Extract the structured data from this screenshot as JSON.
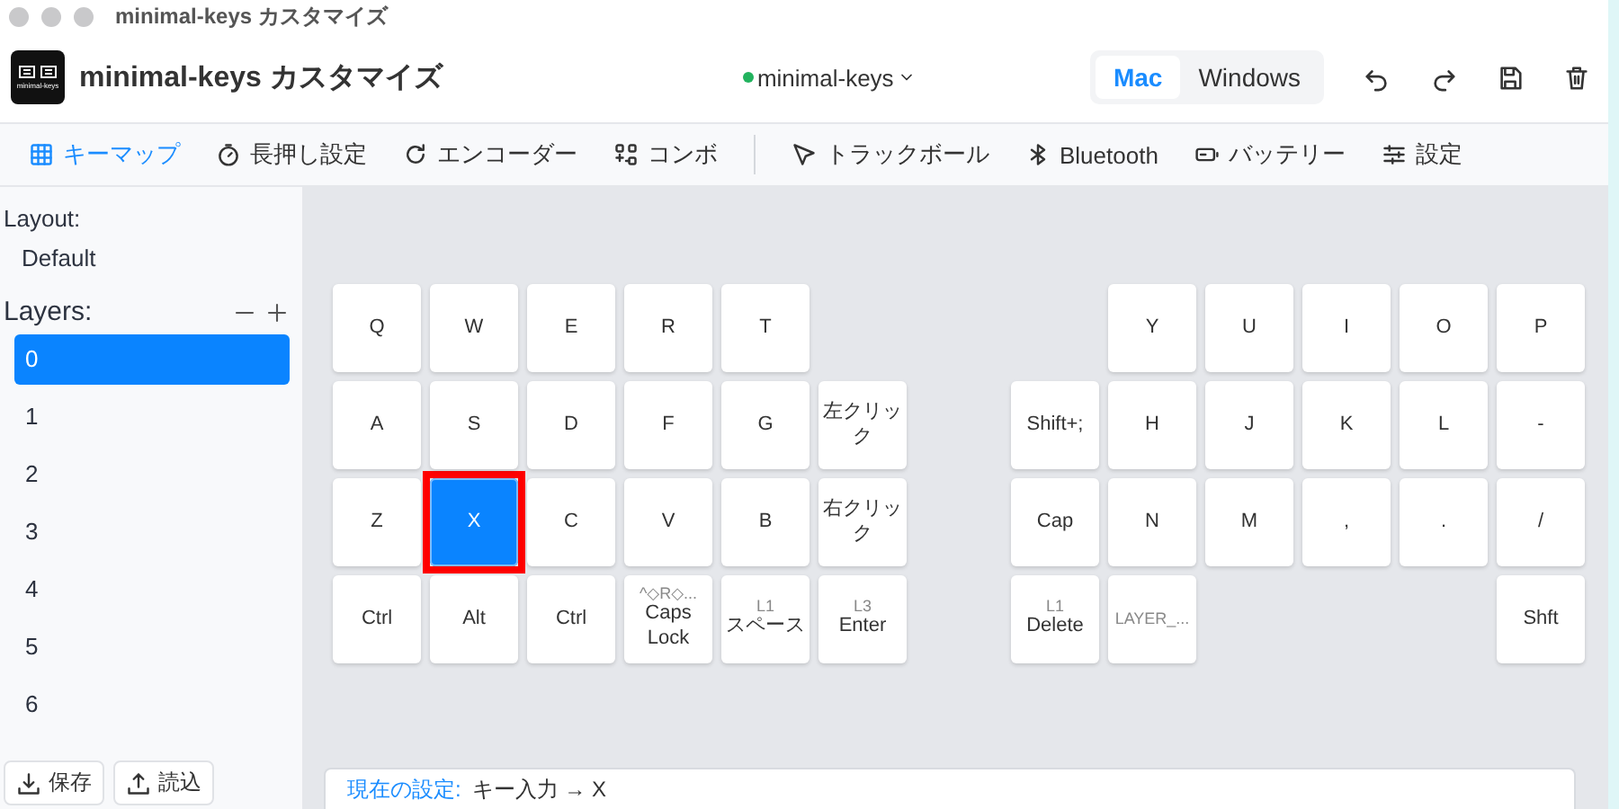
{
  "window": {
    "title": "minimal-keys カスタマイズ"
  },
  "header": {
    "logo_text": "minimal-keys",
    "title": "minimal-keys カスタマイズ",
    "device": {
      "name": "minimal-keys",
      "connected": true
    },
    "os_toggle": [
      {
        "label": "Mac",
        "selected": true
      },
      {
        "label": "Windows",
        "selected": false
      }
    ]
  },
  "toolbar": [
    {
      "label": "キーマップ",
      "selected": true
    },
    {
      "label": "長押し設定",
      "selected": false
    },
    {
      "label": "エンコーダー",
      "selected": false
    },
    {
      "label": "コンボ",
      "selected": false
    },
    {
      "label": "トラックボール",
      "selected": false,
      "divider_before": true
    },
    {
      "label": "Bluetooth",
      "selected": false
    },
    {
      "label": "バッテリー",
      "selected": false
    },
    {
      "label": "設定",
      "selected": false
    }
  ],
  "sidebar": {
    "layout_label": "Layout:",
    "layout_value": "Default",
    "layers_label": "Layers:",
    "layers": [
      {
        "label": "0",
        "selected": true
      },
      {
        "label": "1",
        "selected": false
      },
      {
        "label": "2",
        "selected": false
      },
      {
        "label": "3",
        "selected": false
      },
      {
        "label": "4",
        "selected": false
      },
      {
        "label": "5",
        "selected": false
      },
      {
        "label": "6",
        "selected": false
      }
    ],
    "buttons": [
      {
        "label": "保存"
      },
      {
        "label": "読込"
      }
    ]
  },
  "keyboard": {
    "halves": [
      {
        "rows": [
          [
            {
              "label": "Q",
              "selected": false
            },
            {
              "label": "W",
              "selected": false
            },
            {
              "label": "E",
              "selected": false
            },
            {
              "label": "R",
              "selected": false
            },
            {
              "label": "T",
              "selected": false
            },
            null
          ],
          [
            {
              "label": "A",
              "selected": false
            },
            {
              "label": "S",
              "selected": false
            },
            {
              "label": "D",
              "selected": false
            },
            {
              "label": "F",
              "selected": false
            },
            {
              "label": "G",
              "selected": false
            },
            {
              "label": "左クリック",
              "selected": false
            }
          ],
          [
            {
              "label": "Z",
              "selected": false
            },
            {
              "label": "X",
              "selected": true,
              "marked": true
            },
            {
              "label": "C",
              "selected": false
            },
            {
              "label": "V",
              "selected": false
            },
            {
              "label": "B",
              "selected": false
            },
            {
              "label": "右クリック",
              "selected": false
            }
          ],
          [
            {
              "label": "Ctrl",
              "selected": false
            },
            {
              "label": "Alt",
              "selected": false
            },
            {
              "label": "Ctrl",
              "selected": false
            },
            {
              "label": "Caps Lock",
              "sublabel": "^◇R◇...",
              "selected": false
            },
            {
              "label": "スペース",
              "sublabel": "L1",
              "selected": false
            },
            {
              "label": "Enter",
              "sublabel": "L3",
              "selected": false
            }
          ]
        ]
      },
      {
        "rows": [
          [
            null,
            {
              "label": "Y",
              "selected": false
            },
            {
              "label": "U",
              "selected": false
            },
            {
              "label": "I",
              "selected": false
            },
            {
              "label": "O",
              "selected": false
            },
            {
              "label": "P",
              "selected": false
            }
          ],
          [
            {
              "label": "Shift+;",
              "selected": false
            },
            {
              "label": "H",
              "selected": false
            },
            {
              "label": "J",
              "selected": false
            },
            {
              "label": "K",
              "selected": false
            },
            {
              "label": "L",
              "selected": false
            },
            {
              "label": "-",
              "selected": false
            }
          ],
          [
            {
              "label": "Cap",
              "selected": false
            },
            {
              "label": "N",
              "selected": false
            },
            {
              "label": "M",
              "selected": false
            },
            {
              "label": ",",
              "selected": false
            },
            {
              "label": ".",
              "selected": false
            },
            {
              "label": "/",
              "selected": false
            }
          ],
          [
            {
              "label": "Delete",
              "sublabel": "L1",
              "selected": false
            },
            {
              "sublabel": "LAYER_...",
              "selected": false
            },
            null,
            null,
            null,
            {
              "label": "Shft",
              "selected": false
            }
          ]
        ]
      }
    ]
  },
  "current": {
    "label": "現在の設定:",
    "value": "キー入力 → X"
  }
}
